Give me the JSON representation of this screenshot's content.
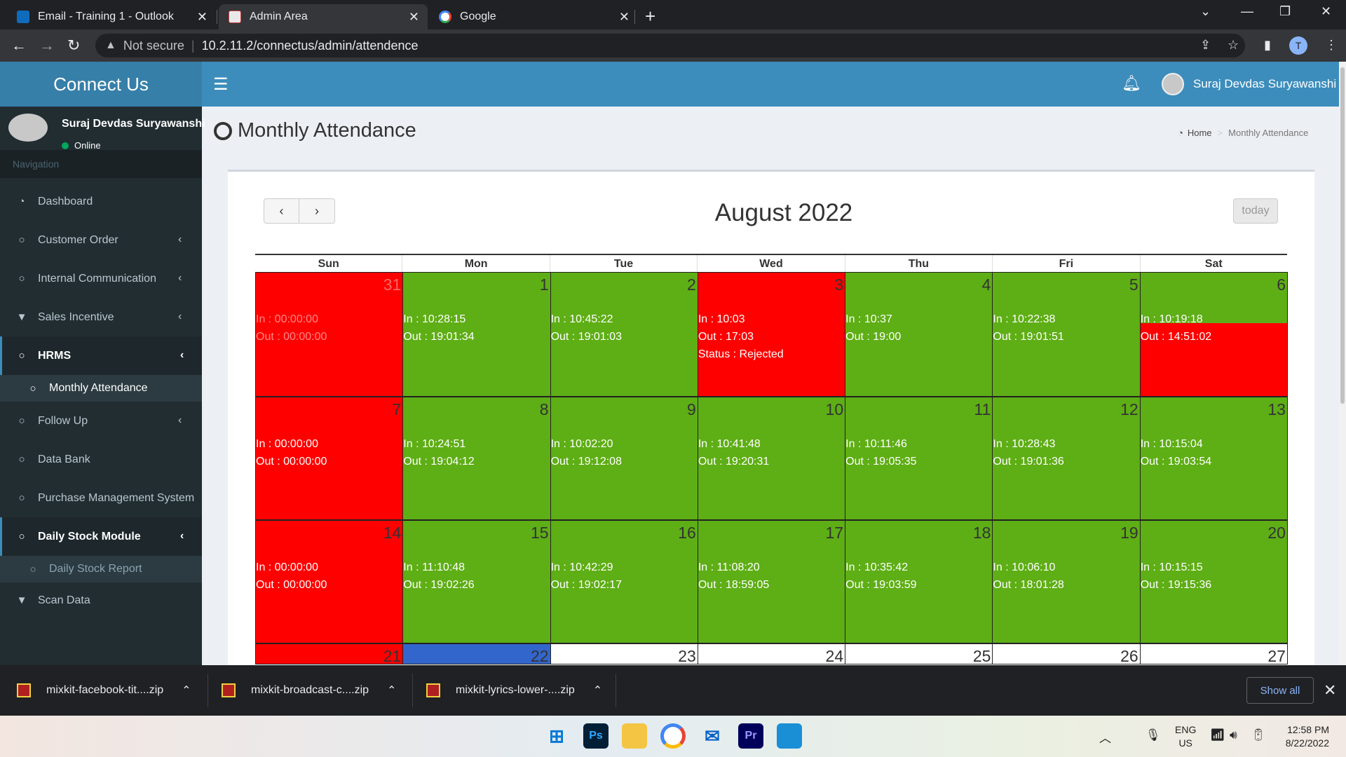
{
  "browser": {
    "tabs": [
      {
        "label": "Email - Training 1 - Outlook",
        "icon": "outlook-icon"
      },
      {
        "label": "Admin Area",
        "icon": "site-favicon-icon"
      },
      {
        "label": "Google",
        "icon": "google-icon"
      }
    ],
    "security_label": "Not secure",
    "url": "10.2.11.2/connectus/admin/attendence",
    "profile_initial": "T"
  },
  "header": {
    "brand": "Connect Us",
    "user_name": "Suraj Devdas Suryawanshi"
  },
  "sidebar": {
    "user_name": "Suraj Devdas Suryawanshi",
    "status": "Online",
    "nav_header": "Navigation",
    "items": [
      {
        "label": "Dashboard"
      },
      {
        "label": "Customer Order"
      },
      {
        "label": "Internal Communication"
      },
      {
        "label": "Sales Incentive"
      },
      {
        "label": "HRMS"
      },
      {
        "label": "Monthly Attendance"
      },
      {
        "label": "Follow Up"
      },
      {
        "label": "Data Bank"
      },
      {
        "label": "Purchase Management System"
      },
      {
        "label": "Daily Stock Module"
      },
      {
        "label": "Daily Stock Report"
      },
      {
        "label": "Scan Data"
      }
    ]
  },
  "page": {
    "title": "Monthly Attendance",
    "breadcrumb_home": "Home",
    "breadcrumb_current": "Monthly Attendance"
  },
  "calendar": {
    "title": "August 2022",
    "today_label": "today",
    "weekdays": [
      "Sun",
      "Mon",
      "Tue",
      "Wed",
      "Thu",
      "Fri",
      "Sat"
    ],
    "colors": {
      "present": "#5eae15",
      "absent": "#ff0000",
      "today": "#3366cc"
    },
    "weeks": [
      [
        {
          "day": "31",
          "status": "absent",
          "other_month": true,
          "lines": [
            "In : 00:00:00",
            "Out : 00:00:00"
          ]
        },
        {
          "day": "1",
          "status": "present",
          "lines": [
            "In : 10:28:15",
            "Out : 19:01:34"
          ]
        },
        {
          "day": "2",
          "status": "present",
          "lines": [
            "In : 10:45:22",
            "Out : 19:01:03"
          ]
        },
        {
          "day": "3",
          "status": "absent",
          "lines": [
            "In : 10:03",
            "Out : 17:03",
            "Status : Rejected"
          ]
        },
        {
          "day": "4",
          "status": "present",
          "lines": [
            "In : 10:37",
            "Out : 19:00"
          ]
        },
        {
          "day": "5",
          "status": "present",
          "lines": [
            "In : 10:22:38",
            "Out : 19:01:51"
          ]
        },
        {
          "day": "6",
          "status": "split",
          "lines": [
            "In : 10:19:18",
            "Out : 14:51:02"
          ]
        }
      ],
      [
        {
          "day": "7",
          "status": "absent",
          "lines": [
            "In : 00:00:00",
            "Out : 00:00:00"
          ]
        },
        {
          "day": "8",
          "status": "present",
          "lines": [
            "In : 10:24:51",
            "Out : 19:04:12"
          ]
        },
        {
          "day": "9",
          "status": "present",
          "lines": [
            "In : 10:02:20",
            "Out : 19:12:08"
          ]
        },
        {
          "day": "10",
          "status": "present",
          "lines": [
            "In : 10:41:48",
            "Out : 19:20:31"
          ]
        },
        {
          "day": "11",
          "status": "present",
          "lines": [
            "In : 10:11:46",
            "Out : 19:05:35"
          ]
        },
        {
          "day": "12",
          "status": "present",
          "lines": [
            "In : 10:28:43",
            "Out : 19:01:36"
          ]
        },
        {
          "day": "13",
          "status": "present",
          "lines": [
            "In : 10:15:04",
            "Out : 19:03:54"
          ]
        }
      ],
      [
        {
          "day": "14",
          "status": "absent",
          "lines": [
            "In : 00:00:00",
            "Out : 00:00:00"
          ]
        },
        {
          "day": "15",
          "status": "present",
          "lines": [
            "In : 11:10:48",
            "Out : 19:02:26"
          ]
        },
        {
          "day": "16",
          "status": "present",
          "lines": [
            "In : 10:42:29",
            "Out : 19:02:17"
          ]
        },
        {
          "day": "17",
          "status": "present",
          "lines": [
            "In : 11:08:20",
            "Out : 18:59:05"
          ]
        },
        {
          "day": "18",
          "status": "present",
          "lines": [
            "In : 10:35:42",
            "Out : 19:03:59"
          ]
        },
        {
          "day": "19",
          "status": "present",
          "lines": [
            "In : 10:06:10",
            "Out : 18:01:28"
          ]
        },
        {
          "day": "20",
          "status": "present",
          "lines": [
            "In : 10:15:15",
            "Out : 19:15:36"
          ]
        }
      ],
      [
        {
          "day": "21",
          "status": "absent",
          "lines": []
        },
        {
          "day": "22",
          "status": "today",
          "lines": []
        },
        {
          "day": "23",
          "status": "none",
          "lines": []
        },
        {
          "day": "24",
          "status": "none",
          "lines": []
        },
        {
          "day": "25",
          "status": "none",
          "lines": []
        },
        {
          "day": "26",
          "status": "none",
          "lines": []
        },
        {
          "day": "27",
          "status": "none",
          "lines": []
        }
      ]
    ]
  },
  "downloads": {
    "items": [
      {
        "label": "mixkit-facebook-tit....zip"
      },
      {
        "label": "mixkit-broadcast-c....zip"
      },
      {
        "label": "mixkit-lyrics-lower-....zip"
      }
    ],
    "show_all": "Show all"
  },
  "taskbar": {
    "lang": "ENG",
    "region": "US",
    "time": "12:58 PM",
    "date": "8/22/2022"
  }
}
